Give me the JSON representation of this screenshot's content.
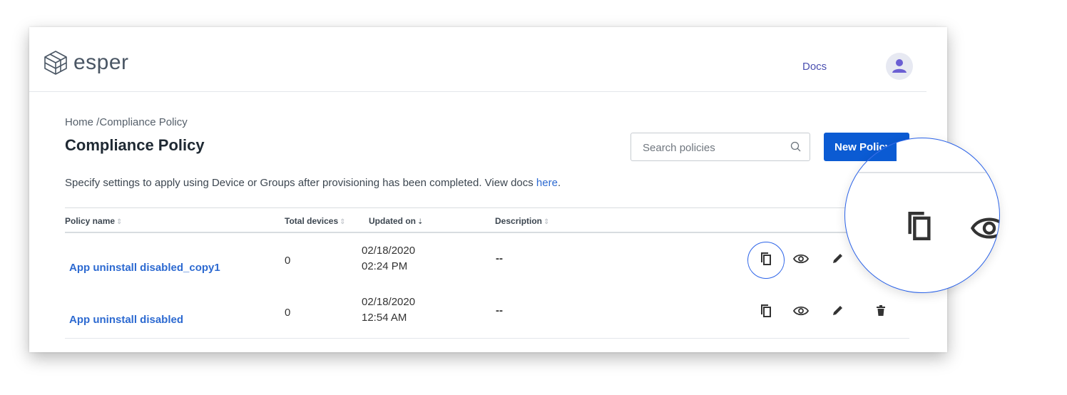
{
  "brand": {
    "name": "esper"
  },
  "header": {
    "docs_label": "Docs"
  },
  "breadcrumb": {
    "home": "Home",
    "separator": " /",
    "current": "Compliance Policy"
  },
  "page": {
    "title": "Compliance Policy",
    "description_prefix": "Specify settings to apply using Device or Groups after provisioning has been completed. View docs ",
    "description_link": "here",
    "description_suffix": "."
  },
  "search": {
    "placeholder": "Search policies"
  },
  "toolbar": {
    "new_policy_label": "New Policy"
  },
  "table": {
    "columns": [
      {
        "label": "Policy name",
        "sort": "sortable"
      },
      {
        "label": "Total devices",
        "sort": "sortable"
      },
      {
        "label": "Updated on",
        "sort": "descending"
      },
      {
        "label": "Description",
        "sort": "sortable"
      }
    ],
    "rows": [
      {
        "name": "App uninstall disabled_copy1",
        "devices": "0",
        "date": "02/18/2020",
        "time": "02:24 PM",
        "description": "--"
      },
      {
        "name": "App uninstall disabled",
        "devices": "0",
        "date": "02/18/2020",
        "time": "12:54 AM",
        "description": "--"
      }
    ],
    "row_actions": [
      "copy-icon",
      "eye-icon",
      "pencil-icon",
      "trash-icon"
    ]
  },
  "colors": {
    "accent": "#0b5bd3",
    "link": "#2d6ad1",
    "brand_purple": "#6b5fd3",
    "highlight_ring": "#2a62e8"
  }
}
